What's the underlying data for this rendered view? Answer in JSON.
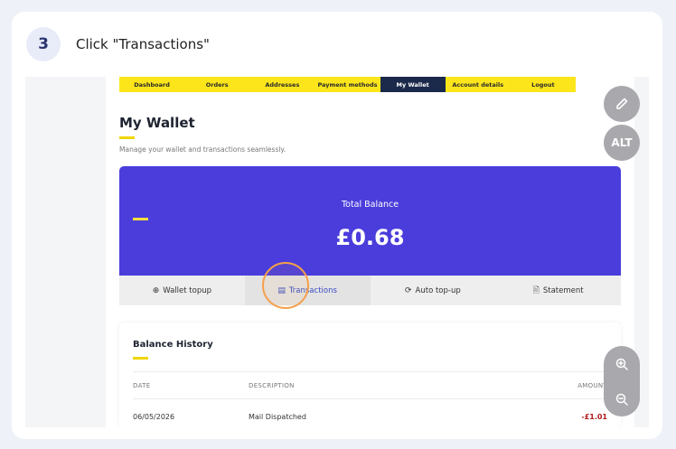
{
  "step": {
    "number": "3",
    "instruction": "Click \"Transactions\""
  },
  "nav": {
    "items": [
      "Dashboard",
      "Orders",
      "Addresses",
      "Payment methods",
      "My Wallet",
      "Account details",
      "Logout"
    ],
    "active": "My Wallet"
  },
  "wallet": {
    "title": "My Wallet",
    "subtitle": "Manage your wallet and transactions seamlessly."
  },
  "balance": {
    "label": "Total Balance",
    "amount": "£0.68"
  },
  "actions": [
    {
      "label": "Wallet topup",
      "icon": "plus-circle-icon"
    },
    {
      "label": "Transactions",
      "icon": "list-icon"
    },
    {
      "label": "Auto top-up",
      "icon": "refresh-icon"
    },
    {
      "label": "Statement",
      "icon": "document-icon"
    }
  ],
  "history": {
    "title": "Balance History",
    "columns": {
      "date": "DATE",
      "description": "DESCRIPTION",
      "amount": "AMOUNT"
    },
    "rows": [
      {
        "date": "06/05/2026",
        "description": "Mail Dispatched",
        "amount": "-£1.01"
      }
    ]
  },
  "fabs": {
    "edit_icon": "pencil-icon",
    "alt_label": "ALT",
    "zoom_in_icon": "zoom-in-icon",
    "zoom_out_icon": "zoom-out-icon"
  },
  "colors": {
    "nav_bg": "#fce61b",
    "nav_active": "#1b2a4a",
    "balance_bg": "#4a3ddb",
    "highlight": "#f5a04a",
    "negative_amount": "#b11a1a"
  }
}
